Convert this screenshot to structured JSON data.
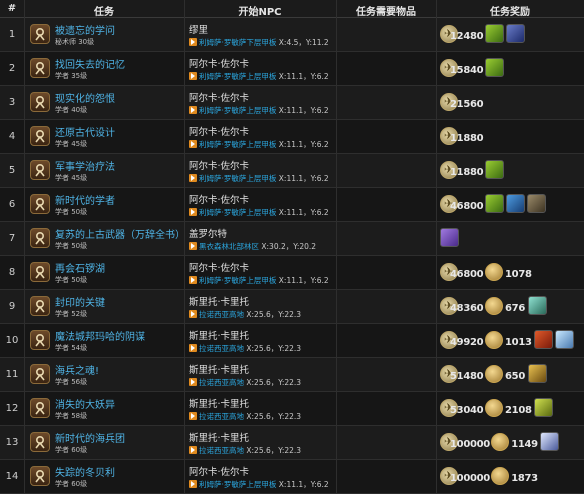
{
  "headers": {
    "num": "#",
    "quest": "任务",
    "npc": "开始NPC",
    "items": "任务需要物品",
    "reward": "任务奖励"
  },
  "rows": [
    {
      "num": "1",
      "name": "被遗忘的学问",
      "req": "秘术师 30级",
      "npc": "缪里",
      "loc_area": "利姆萨·罗敏萨下层甲板",
      "loc_coord": "X:4.5，Y:11.2",
      "xp": "12480",
      "gil": "",
      "items": [
        "green",
        "blue-white"
      ]
    },
    {
      "num": "2",
      "name": "找回失去的记忆",
      "req": "学者 35级",
      "npc": "阿尔卡·佐尔卡",
      "loc_area": "利姆萨·罗敏萨上层甲板",
      "loc_coord": "X:11.1，Y:6.2",
      "xp": "15840",
      "gil": "",
      "items": [
        "green"
      ]
    },
    {
      "num": "3",
      "name": "现实化的怨恨",
      "req": "学者 40级",
      "npc": "阿尔卡·佐尔卡",
      "loc_area": "利姆萨·罗敏萨上层甲板",
      "loc_coord": "X:11.1，Y:6.2",
      "xp": "21560",
      "gil": "",
      "items": []
    },
    {
      "num": "4",
      "name": "还原古代设计",
      "req": "学者 45级",
      "npc": "阿尔卡·佐尔卡",
      "loc_area": "利姆萨·罗敏萨上层甲板",
      "loc_coord": "X:11.1，Y:6.2",
      "xp": "11880",
      "gil": "",
      "items": []
    },
    {
      "num": "5",
      "name": "军事学治疗法",
      "req": "学者 45级",
      "npc": "阿尔卡·佐尔卡",
      "loc_area": "利姆萨·罗敏萨上层甲板",
      "loc_coord": "X:11.1，Y:6.2",
      "xp": "11880",
      "gil": "",
      "items": [
        "green"
      ]
    },
    {
      "num": "6",
      "name": "新时代的学者",
      "req": "学者 50级",
      "npc": "阿尔卡·佐尔卡",
      "loc_area": "利姆萨·罗敏萨上层甲板",
      "loc_coord": "X:11.1，Y:6.2",
      "xp": "46800",
      "gil": "",
      "items": [
        "green",
        "blue",
        "brown"
      ]
    },
    {
      "num": "7",
      "name": "复苏的上古武器（万辞全书）",
      "req": "学者 50级",
      "npc": "盖罗尔特",
      "loc_area": "黑衣森林北部林区",
      "loc_coord": "X:30.2，Y:20.2",
      "xp": "",
      "gil": "",
      "items": [
        "purple"
      ]
    },
    {
      "num": "8",
      "name": "再会石锣湖",
      "req": "学者 50级",
      "npc": "阿尔卡·佐尔卡",
      "loc_area": "利姆萨·罗敏萨上层甲板",
      "loc_coord": "X:11.1，Y:6.2",
      "xp": "46800",
      "gil": "1078",
      "items": []
    },
    {
      "num": "9",
      "name": "封印的关键",
      "req": "学者 52级",
      "npc": "斯里托·卡里托",
      "loc_area": "拉诺西亚高地",
      "loc_coord": "X:25.6，Y:22.3",
      "xp": "48360",
      "gil": "676",
      "items": [
        "teal"
      ]
    },
    {
      "num": "10",
      "name": "魔法城邦玛哈的阴谋",
      "req": "学者 54级",
      "npc": "斯里托·卡里托",
      "loc_area": "拉诺西亚高地",
      "loc_coord": "X:25.6，Y:22.3",
      "xp": "49920",
      "gil": "1013",
      "items": [
        "red",
        "light"
      ]
    },
    {
      "num": "11",
      "name": "海兵之魂!",
      "req": "学者 56级",
      "npc": "斯里托·卡里托",
      "loc_area": "拉诺西亚高地",
      "loc_coord": "X:25.6，Y:22.3",
      "xp": "51480",
      "gil": "650",
      "items": [
        "gold"
      ]
    },
    {
      "num": "12",
      "name": "消失的大妖异",
      "req": "学者 58级",
      "npc": "斯里托·卡里托",
      "loc_area": "拉诺西亚高地",
      "loc_coord": "X:25.6，Y:22.3",
      "xp": "53040",
      "gil": "2108",
      "items": [
        "yellowgreen"
      ]
    },
    {
      "num": "13",
      "name": "新时代的海兵团",
      "req": "学者 60级",
      "npc": "斯里托·卡里托",
      "loc_area": "拉诺西亚高地",
      "loc_coord": "X:25.6，Y:22.3",
      "xp": "100000",
      "gil": "1149",
      "items": [
        "white-blue"
      ]
    },
    {
      "num": "14",
      "name": "失踪的冬贝利",
      "req": "学者 60级",
      "npc": "阿尔卡·佐尔卡",
      "loc_area": "利姆萨·罗敏萨上层甲板",
      "loc_coord": "X:11.1，Y:6.2",
      "xp": "100000",
      "gil": "1873",
      "items": []
    }
  ],
  "colors": {
    "quest_link": "#4fb4e6",
    "area_link": "#2ba6de",
    "map_marker": "#e08a1e"
  },
  "icons": {
    "quest": "job-quest-icon",
    "exp": "exp-icon",
    "gil": "gil-coin-icon",
    "map": "map-marker-icon"
  }
}
